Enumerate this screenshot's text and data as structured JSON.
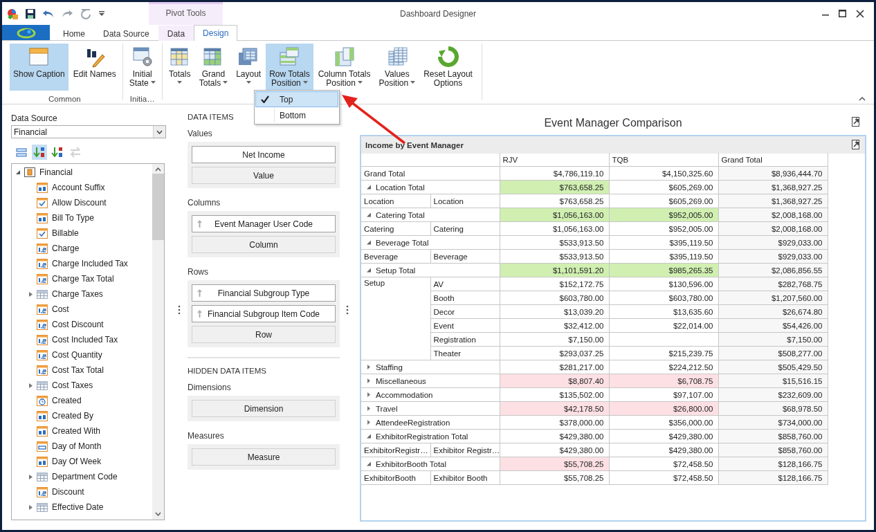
{
  "window": {
    "title": "Dashboard Designer"
  },
  "context_tab_group": "Pivot Tools",
  "tabs": [
    {
      "label": "Home",
      "selected": false
    },
    {
      "label": "Data Source",
      "selected": false
    },
    {
      "label": "Data",
      "selected": false
    },
    {
      "label": "Design",
      "selected": true
    }
  ],
  "ribbon": {
    "groups": [
      {
        "label": "Common",
        "buttons": [
          {
            "lines": [
              "Show Caption"
            ],
            "selected": true,
            "dropdown": false
          },
          {
            "lines": [
              "Edit Names"
            ],
            "selected": false,
            "dropdown": false
          }
        ]
      },
      {
        "label": "Initia…",
        "buttons": [
          {
            "lines": [
              "Initial",
              "State"
            ],
            "selected": false,
            "dropdown": true
          }
        ]
      },
      {
        "buttons": [
          {
            "lines": [
              "Totals"
            ],
            "selected": false,
            "dropdown": true
          },
          {
            "lines": [
              "Grand",
              "Totals"
            ],
            "selected": false,
            "dropdown": true
          },
          {
            "lines": [
              "Layout"
            ],
            "selected": false,
            "dropdown": true
          },
          {
            "lines": [
              "Row Totals",
              "Position"
            ],
            "selected": true,
            "dropdown": true
          },
          {
            "lines": [
              "Column Totals",
              "Position"
            ],
            "selected": false,
            "dropdown": true
          },
          {
            "lines": [
              "Values",
              "Position"
            ],
            "selected": false,
            "dropdown": true
          },
          {
            "lines": [
              "Reset Layout",
              "Options"
            ],
            "selected": false,
            "dropdown": false
          }
        ]
      }
    ]
  },
  "menu": {
    "items": [
      {
        "label": "Top",
        "checked": true,
        "selected": true
      },
      {
        "label": "Bottom",
        "checked": false,
        "selected": false
      }
    ]
  },
  "data_source": {
    "label": "Data Source",
    "value": "Financial"
  },
  "field_toolbar": [
    {
      "selected": false,
      "disabled": false
    },
    {
      "selected": true,
      "disabled": false
    },
    {
      "selected": false,
      "disabled": false
    },
    {
      "selected": false,
      "disabled": true
    }
  ],
  "field_tree": {
    "label": "Financial",
    "expanded": true,
    "children": [
      {
        "label": "Account Suffix",
        "kind": "text"
      },
      {
        "label": "Allow Discount",
        "kind": "boolean"
      },
      {
        "label": "Bill To Type",
        "kind": "text"
      },
      {
        "label": "Billable",
        "kind": "boolean"
      },
      {
        "label": "Charge",
        "kind": "number"
      },
      {
        "label": "Charge Included Tax",
        "kind": "number"
      },
      {
        "label": "Charge Tax Total",
        "kind": "number"
      },
      {
        "label": "Charge Taxes",
        "kind": "table",
        "expanded": false
      },
      {
        "label": "Cost",
        "kind": "number"
      },
      {
        "label": "Cost Discount",
        "kind": "number"
      },
      {
        "label": "Cost Included Tax",
        "kind": "number"
      },
      {
        "label": "Cost Quantity",
        "kind": "number"
      },
      {
        "label": "Cost Tax Total",
        "kind": "number"
      },
      {
        "label": "Cost Taxes",
        "kind": "table",
        "expanded": false
      },
      {
        "label": "Created",
        "kind": "date"
      },
      {
        "label": "Created By",
        "kind": "text"
      },
      {
        "label": "Created With",
        "kind": "text"
      },
      {
        "label": "Day of Month",
        "kind": "integer"
      },
      {
        "label": "Day Of Week",
        "kind": "text"
      },
      {
        "label": "Department Code",
        "kind": "table",
        "expanded": false
      },
      {
        "label": "Discount",
        "kind": "number"
      },
      {
        "label": "Effective Date",
        "kind": "table",
        "expanded": false
      }
    ]
  },
  "data_items": {
    "title": "DATA ITEMS",
    "sections": [
      {
        "label": "Values",
        "items": [
          {
            "label": "Net Income",
            "kind": "measure"
          },
          {
            "label": "Value",
            "kind": "empty"
          }
        ]
      },
      {
        "label": "Columns",
        "items": [
          {
            "label": "Event Manager User Code",
            "kind": "dimension"
          },
          {
            "label": "Column",
            "kind": "empty"
          }
        ]
      },
      {
        "label": "Rows",
        "items": [
          {
            "label": "Financial Subgroup Type",
            "kind": "dimension"
          },
          {
            "label": "Financial Subgroup Item Code",
            "kind": "dimension"
          },
          {
            "label": "Row",
            "kind": "empty"
          }
        ]
      }
    ]
  },
  "hidden_data_items": {
    "title": "HIDDEN DATA ITEMS",
    "sections": [
      {
        "label": "Dimensions",
        "items": [
          {
            "label": "Dimension",
            "kind": "empty"
          }
        ]
      },
      {
        "label": "Measures",
        "items": [
          {
            "label": "Measure",
            "kind": "empty"
          }
        ]
      }
    ]
  },
  "dashboard": {
    "title": "Event Manager Comparison",
    "pivot": {
      "caption": "Income by Event Manager",
      "columns": [
        "RJV",
        "TQB",
        "Grand Total"
      ],
      "rows": [
        {
          "kind": "grand",
          "label": "Grand Total",
          "cells": [
            {
              "value": "$4,786,119.10"
            },
            {
              "value": "$4,150,325.60"
            },
            {
              "value": "$8,936,444.70"
            }
          ]
        },
        {
          "kind": "total",
          "label": "Location Total",
          "expanded": true,
          "cells": [
            {
              "value": "$763,658.25",
              "color": "#d0efb1"
            },
            {
              "value": "$605,269.00"
            },
            {
              "value": "$1,368,927.25"
            }
          ]
        },
        {
          "kind": "detail",
          "group": "Location",
          "label": "Location",
          "cells": [
            {
              "value": "$763,658.25"
            },
            {
              "value": "$605,269.00"
            },
            {
              "value": "$1,368,927.25"
            }
          ]
        },
        {
          "kind": "total",
          "label": "Catering Total",
          "expanded": true,
          "cells": [
            {
              "value": "$1,056,163.00",
              "color": "#d0efb1"
            },
            {
              "value": "$952,005.00",
              "color": "#d0efb1"
            },
            {
              "value": "$2,008,168.00"
            }
          ]
        },
        {
          "kind": "detail",
          "group": "Catering",
          "label": "Catering",
          "cells": [
            {
              "value": "$1,056,163.00"
            },
            {
              "value": "$952,005.00"
            },
            {
              "value": "$2,008,168.00"
            }
          ]
        },
        {
          "kind": "total",
          "label": "Beverage Total",
          "expanded": true,
          "cells": [
            {
              "value": "$533,913.50"
            },
            {
              "value": "$395,119.50"
            },
            {
              "value": "$929,033.00"
            }
          ]
        },
        {
          "kind": "detail",
          "group": "Beverage",
          "label": "Beverage",
          "cells": [
            {
              "value": "$533,913.50"
            },
            {
              "value": "$395,119.50"
            },
            {
              "value": "$929,033.00"
            }
          ]
        },
        {
          "kind": "total",
          "label": "Setup Total",
          "expanded": true,
          "cells": [
            {
              "value": "$1,101,591.20",
              "color": "#d0efb1"
            },
            {
              "value": "$985,265.35",
              "color": "#d0efb1"
            },
            {
              "value": "$2,086,856.55"
            }
          ]
        },
        {
          "kind": "detail",
          "group": "Setup",
          "label": "AV",
          "cells": [
            {
              "value": "$152,172.75"
            },
            {
              "value": "$130,596.00"
            },
            {
              "value": "$282,768.75"
            }
          ]
        },
        {
          "kind": "detail",
          "label": "Booth",
          "cells": [
            {
              "value": "$603,780.00"
            },
            {
              "value": "$603,780.00"
            },
            {
              "value": "$1,207,560.00"
            }
          ]
        },
        {
          "kind": "detail",
          "label": "Decor",
          "cells": [
            {
              "value": "$13,039.20"
            },
            {
              "value": "$13,635.60"
            },
            {
              "value": "$26,674.80"
            }
          ]
        },
        {
          "kind": "detail",
          "label": "Event",
          "cells": [
            {
              "value": "$32,412.00"
            },
            {
              "value": "$22,014.00"
            },
            {
              "value": "$54,426.00"
            }
          ]
        },
        {
          "kind": "detail",
          "label": "Registration",
          "cells": [
            {
              "value": "$7,150.00"
            },
            {},
            {
              "value": "$7,150.00"
            }
          ]
        },
        {
          "kind": "detail",
          "label": "Theater",
          "cells": [
            {
              "value": "$293,037.25"
            },
            {
              "value": "$215,239.75"
            },
            {
              "value": "$508,277.00"
            }
          ]
        },
        {
          "kind": "total",
          "label": "Staffing",
          "expanded": false,
          "cells": [
            {
              "value": "$281,217.00"
            },
            {
              "value": "$224,212.50"
            },
            {
              "value": "$505,429.50"
            }
          ]
        },
        {
          "kind": "total",
          "label": "Miscellaneous",
          "expanded": false,
          "cells": [
            {
              "value": "$8,807.40",
              "color": "#fde0e4"
            },
            {
              "value": "$6,708.75",
              "color": "#fde0e4"
            },
            {
              "value": "$15,516.15"
            }
          ]
        },
        {
          "kind": "total",
          "label": "Accommodation",
          "expanded": false,
          "cells": [
            {
              "value": "$135,502.00"
            },
            {
              "value": "$97,107.00"
            },
            {
              "value": "$232,609.00"
            }
          ]
        },
        {
          "kind": "total",
          "label": "Travel",
          "expanded": false,
          "cells": [
            {
              "value": "$42,178.50",
              "color": "#fde0e4"
            },
            {
              "value": "$26,800.00",
              "color": "#fde0e4"
            },
            {
              "value": "$68,978.50"
            }
          ]
        },
        {
          "kind": "total",
          "label": "AttendeeRegistration",
          "expanded": false,
          "cells": [
            {
              "value": "$378,000.00"
            },
            {
              "value": "$356,000.00"
            },
            {
              "value": "$734,000.00"
            }
          ]
        },
        {
          "kind": "total",
          "label": "ExhibitorRegistration Total",
          "expanded": true,
          "cells": [
            {
              "value": "$429,380.00"
            },
            {
              "value": "$429,380.00"
            },
            {
              "value": "$858,760.00"
            }
          ]
        },
        {
          "kind": "detail",
          "group": "ExhibitorRegistr…",
          "label": "Exhibitor Registr…",
          "cells": [
            {
              "value": "$429,380.00"
            },
            {
              "value": "$429,380.00"
            },
            {
              "value": "$858,760.00"
            }
          ]
        },
        {
          "kind": "total",
          "label": "ExhibitorBooth Total",
          "expanded": true,
          "cells": [
            {
              "value": "$55,708.25",
              "color": "#fde0e4"
            },
            {
              "value": "$72,458.50"
            },
            {
              "value": "$128,166.75"
            }
          ]
        },
        {
          "kind": "detail",
          "group": "ExhibitorBooth",
          "label": "Exhibitor Booth",
          "cells": [
            {
              "value": "$55,708.25"
            },
            {
              "value": "$72,458.50"
            },
            {
              "value": "$128,166.75"
            }
          ]
        }
      ]
    }
  }
}
